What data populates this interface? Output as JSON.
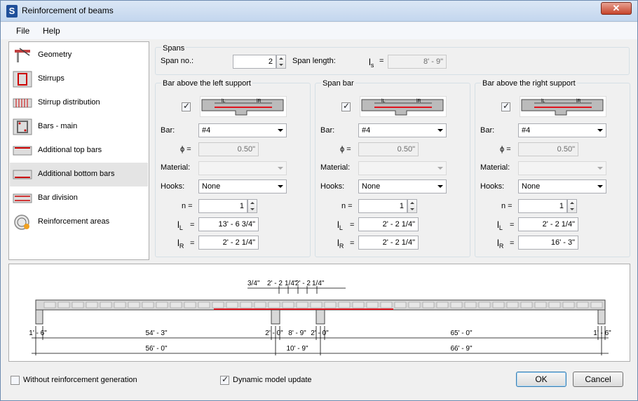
{
  "window": {
    "title": "Reinforcement of beams",
    "icon_letter": "S",
    "close_label": "✕"
  },
  "menu": {
    "file": "File",
    "help": "Help"
  },
  "sidebar": {
    "items": [
      {
        "label": "Geometry",
        "icon": "geometry-icon"
      },
      {
        "label": "Stirrups",
        "icon": "stirrups-icon"
      },
      {
        "label": "Stirrup distribution",
        "icon": "stirrup-distribution-icon"
      },
      {
        "label": "Bars - main",
        "icon": "bars-main-icon"
      },
      {
        "label": "Additional top bars",
        "icon": "additional-top-bars-icon"
      },
      {
        "label": "Additional bottom bars",
        "icon": "additional-bottom-bars-icon",
        "selected": true
      },
      {
        "label": "Bar division",
        "icon": "bar-division-icon"
      },
      {
        "label": "Reinforcement areas",
        "icon": "reinforcement-areas-icon"
      }
    ]
  },
  "spans": {
    "title": "Spans",
    "span_no_label": "Span no.:",
    "span_no_value": "2",
    "span_length_label": "Span length:",
    "ls_symbol": "l",
    "ls_sub": "s",
    "ls_eq": "=",
    "span_length_value": "8' - 9\""
  },
  "panels": [
    {
      "title": "Bar above the left support",
      "checked": true,
      "bar_label": "Bar:",
      "bar_value": "#4",
      "phi_label": "ϕ =",
      "phi_value": "0.50\"",
      "material_label": "Material:",
      "material_value": "",
      "hooks_label": "Hooks:",
      "hooks_value": "None",
      "n_label": "n =",
      "n_value": "1",
      "lL_symbol": "l",
      "lL_sub": "L",
      "lL_eq": "=",
      "lL_value": "13' - 6 3/4\"",
      "lR_symbol": "l",
      "lR_sub": "R",
      "lR_eq": "=",
      "lR_value": "2' - 2 1/4\""
    },
    {
      "title": "Span bar",
      "checked": true,
      "bar_label": "Bar:",
      "bar_value": "#4",
      "phi_label": "ϕ =",
      "phi_value": "0.50\"",
      "material_label": "Material:",
      "material_value": "",
      "hooks_label": "Hooks:",
      "hooks_value": "None",
      "n_label": "n =",
      "n_value": "1",
      "lL_symbol": "l",
      "lL_sub": "L",
      "lL_eq": "=",
      "lL_value": "2' - 2 1/4\"",
      "lR_symbol": "l",
      "lR_sub": "R",
      "lR_eq": "=",
      "lR_value": "2' - 2 1/4\""
    },
    {
      "title": "Bar above the right support",
      "checked": true,
      "bar_label": "Bar:",
      "bar_value": "#4",
      "phi_label": "ϕ =",
      "phi_value": "0.50\"",
      "material_label": "Material:",
      "material_value": "",
      "hooks_label": "Hooks:",
      "hooks_value": "None",
      "n_label": "n =",
      "n_value": "1",
      "lL_symbol": "l",
      "lL_sub": "L",
      "lL_eq": "=",
      "lL_value": "2' - 2 1/4\"",
      "lR_symbol": "l",
      "lR_sub": "R",
      "lR_eq": "=",
      "lR_value": "16' - 3\""
    }
  ],
  "diagram_labels": {
    "L": "lL",
    "R": "lR"
  },
  "preview": {
    "top_dims": [
      "3/4\"",
      "2' - 2",
      "1/4\"",
      "2' - 2",
      "1/4\""
    ],
    "row1": [
      "1' - 6\"",
      "54' - 3\"",
      "2' - 0\"",
      "8' - 9\"",
      "2' - 0\"",
      "65' - 0\"",
      "1' - 6\""
    ],
    "row2": [
      "56' - 0\"",
      "10' - 9\"",
      "66' - 9\""
    ]
  },
  "footer": {
    "without_generation_label": "Without reinforcement generation",
    "without_generation_checked": false,
    "dynamic_update_label": "Dynamic model update",
    "dynamic_update_checked": true,
    "ok_label": "OK",
    "cancel_label": "Cancel"
  },
  "colors": {
    "bar_red": "#e0141e",
    "beam_gray": "#c8c8c8"
  }
}
